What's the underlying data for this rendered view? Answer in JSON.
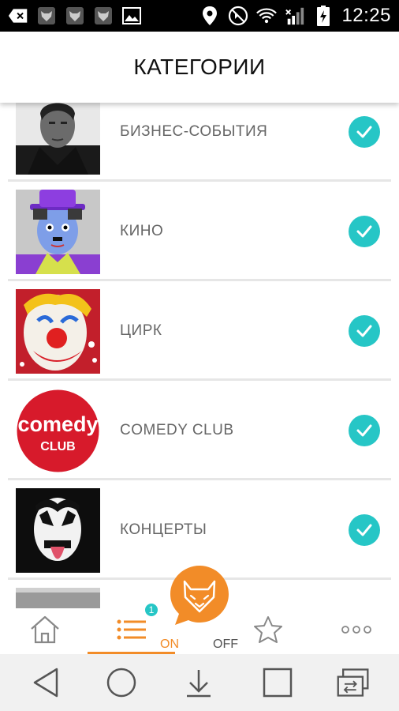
{
  "status_bar": {
    "time": "12:25",
    "left_icons": [
      "back-notification-icon",
      "fox-notification-icon",
      "fox-notification-icon",
      "fox-notification-icon",
      "image-icon"
    ],
    "right_icons": [
      "location-icon",
      "mute-icon",
      "wifi-icon",
      "signal-icon",
      "battery-charging-icon"
    ]
  },
  "header": {
    "title": "КАТЕГОРИИ"
  },
  "categories": [
    {
      "label": "БИЗНЕС-СОБЫТИЯ",
      "checked": true,
      "image": "business-photo"
    },
    {
      "label": "КИНО",
      "checked": true,
      "image": "chaplin-photo"
    },
    {
      "label": "ЦИРК",
      "checked": true,
      "image": "clown-photo"
    },
    {
      "label": "COMEDY CLUB",
      "checked": true,
      "image": "comedy-club-logo",
      "logo_text": [
        "comedy",
        "CLUB"
      ]
    },
    {
      "label": "КОНЦЕРТЫ",
      "checked": true,
      "image": "kiss-photo"
    }
  ],
  "bottom_nav": {
    "items": [
      "home-icon",
      "list-icon",
      "star-icon",
      "more-icon"
    ],
    "badge_count": "1",
    "toggle_on": "ON",
    "toggle_off": "OFF"
  },
  "colors": {
    "accent": "#f28c28",
    "check": "#26c6c6"
  }
}
